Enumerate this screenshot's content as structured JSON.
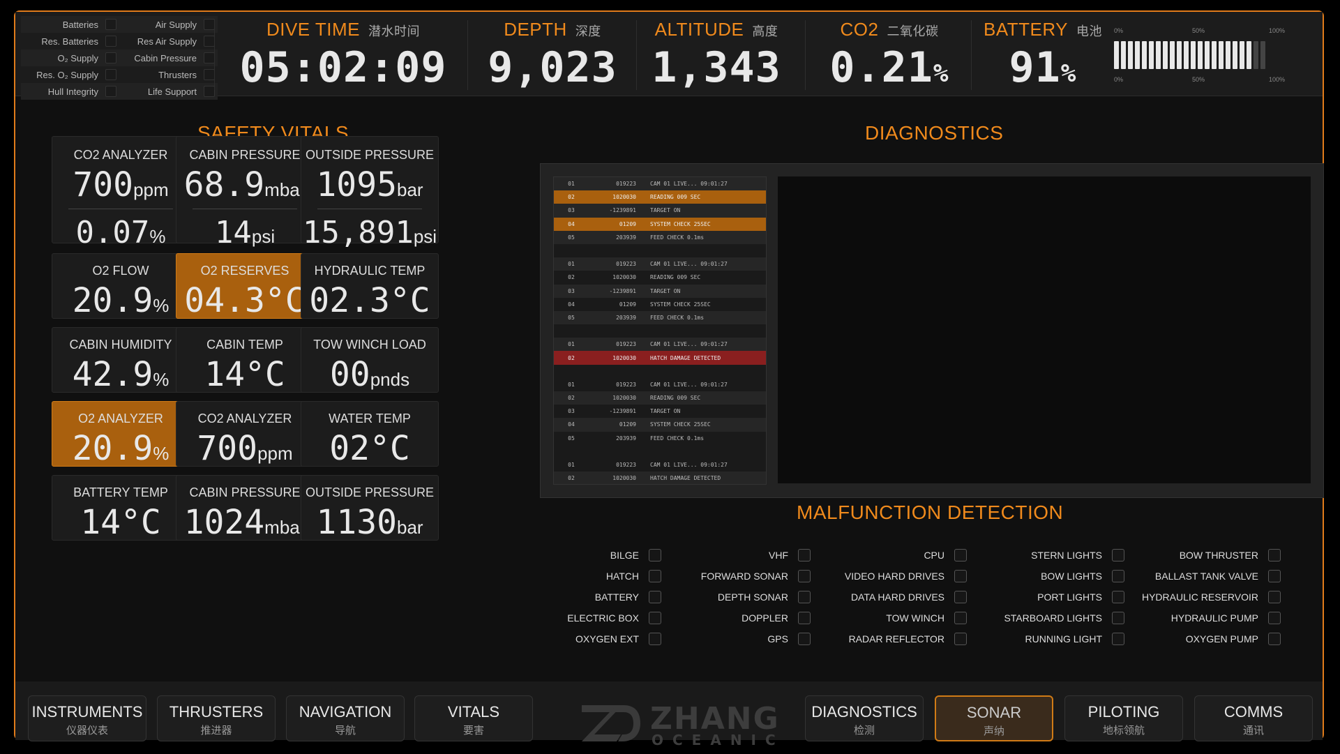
{
  "status_panel": [
    {
      "left": "Batteries",
      "right": "Air Supply"
    },
    {
      "left": "Res. Batteries",
      "right": "Res Air Supply"
    },
    {
      "left": "O₂ Supply",
      "right": "Cabin Pressure"
    },
    {
      "left": "Res. O₂ Supply",
      "right": "Thrusters"
    },
    {
      "left": "Hull Integrity",
      "right": "Life Support"
    }
  ],
  "metrics": {
    "dive_time": {
      "label": "DIVE TIME",
      "zh": "潜水时间",
      "value": "05:02:09"
    },
    "depth": {
      "label": "DEPTH",
      "zh": "深度",
      "value": "9,023"
    },
    "altitude": {
      "label": "ALTITUDE",
      "zh": "高度",
      "value": "1,343"
    },
    "co2": {
      "label": "CO2",
      "zh": "二氧化碳",
      "value": "0.21",
      "unit": "%"
    },
    "battery": {
      "label": "BATTERY",
      "zh": "电池",
      "value": "91",
      "unit": "%"
    }
  },
  "battery_gauge": {
    "level_percent": 91,
    "scale": [
      "0%",
      "50%",
      "100%"
    ]
  },
  "safety_vitals": {
    "title": "SAFETY VITALS",
    "tiles": [
      {
        "label": "CO2 ANALYZER",
        "value": "700",
        "unit": "ppm",
        "value2": "0.07",
        "unit2": "%"
      },
      {
        "label": "CABIN PRESSURE",
        "value": "68.9",
        "unit": "mbar",
        "value2": "14",
        "unit2": "psi"
      },
      {
        "label": "OUTSIDE PRESSURE",
        "value": "1095",
        "unit": "bar",
        "value2": "15,891",
        "unit2": "psi"
      },
      {
        "label": "O2 FLOW",
        "value": "20.9",
        "unit": "%"
      },
      {
        "label": "O2 RESERVES",
        "value": "04.3°C",
        "unit": "",
        "alert": true
      },
      {
        "label": "HYDRAULIC TEMP",
        "value": "02.3°C",
        "unit": ""
      },
      {
        "label": "CABIN HUMIDITY",
        "value": "42.9",
        "unit": "%"
      },
      {
        "label": "CABIN TEMP",
        "value": "14°C",
        "unit": ""
      },
      {
        "label": "TOW WINCH LOAD",
        "value": "00",
        "unit": "pnds"
      },
      {
        "label": "O2 ANALYZER",
        "value": "20.9",
        "unit": "%",
        "alert": true
      },
      {
        "label": "CO2 ANALYZER",
        "value": "700",
        "unit": "ppm"
      },
      {
        "label": "WATER TEMP",
        "value": "02°C",
        "unit": ""
      },
      {
        "label": "BATTERY TEMP",
        "value": "14°C",
        "unit": ""
      },
      {
        "label": "CABIN PRESSURE",
        "value": "1024",
        "unit": "mbar"
      },
      {
        "label": "OUTSIDE PRESSURE",
        "value": "1130",
        "unit": "bar"
      }
    ]
  },
  "diagnostics": {
    "title": "DIAGNOSTICS",
    "log": [
      {
        "id": "01",
        "code": "019223",
        "msg": "CAM 01 LIVE... 09:01:27"
      },
      {
        "id": "02",
        "code": "1020030",
        "msg": "READING 009 SEC",
        "state": "warn"
      },
      {
        "id": "03",
        "code": "-1239891",
        "msg": "TARGET ON"
      },
      {
        "id": "04",
        "code": "01209",
        "msg": "SYSTEM CHECK 25SEC",
        "state": "warn"
      },
      {
        "id": "05",
        "code": "203939",
        "msg": "FEED CHECK 0.1ms"
      },
      {
        "blank": true
      },
      {
        "id": "01",
        "code": "019223",
        "msg": "CAM 01 LIVE... 09:01:27"
      },
      {
        "id": "02",
        "code": "1020030",
        "msg": "READING 009 SEC"
      },
      {
        "id": "03",
        "code": "-1239891",
        "msg": "TARGET ON"
      },
      {
        "id": "04",
        "code": "01209",
        "msg": "SYSTEM CHECK 25SEC"
      },
      {
        "id": "05",
        "code": "203939",
        "msg": "FEED CHECK 0.1ms"
      },
      {
        "blank": true
      },
      {
        "id": "01",
        "code": "019223",
        "msg": "CAM 01 LIVE... 09:01:27"
      },
      {
        "id": "02",
        "code": "1020030",
        "msg": "HATCH DAMAGE DETECTED",
        "state": "crit"
      },
      {
        "blank": true
      },
      {
        "id": "01",
        "code": "019223",
        "msg": "CAM 01 LIVE... 09:01:27"
      },
      {
        "id": "02",
        "code": "1020030",
        "msg": "READING 009 SEC"
      },
      {
        "id": "03",
        "code": "-1239891",
        "msg": "TARGET ON"
      },
      {
        "id": "04",
        "code": "01209",
        "msg": "SYSTEM CHECK 25SEC"
      },
      {
        "id": "05",
        "code": "203939",
        "msg": "FEED CHECK 0.1ms"
      },
      {
        "blank": true
      },
      {
        "id": "01",
        "code": "019223",
        "msg": "CAM 01 LIVE... 09:01:27"
      },
      {
        "id": "02",
        "code": "1020030",
        "msg": "HATCH DAMAGE DETECTED"
      }
    ]
  },
  "malfunction": {
    "title": "MALFUNCTION DETECTION",
    "columns": [
      [
        "BILGE",
        "HATCH",
        "BATTERY",
        "ELECTRIC BOX",
        "OXYGEN EXT"
      ],
      [
        "VHF",
        "FORWARD SONAR",
        "DEPTH SONAR",
        "DOPPLER",
        "GPS"
      ],
      [
        "CPU",
        "VIDEO HARD DRIVES",
        "DATA HARD DRIVES",
        "TOW WINCH",
        "RADAR REFLECTOR"
      ],
      [
        "STERN LIGHTS",
        "BOW LIGHTS",
        "PORT LIGHTS",
        "STARBOARD LIGHTS",
        "RUNNING LIGHT"
      ],
      [
        "BOW THRUSTER",
        "BALLAST TANK VALVE",
        "HYDRAULIC RESERVOIR",
        "HYDRAULIC PUMP",
        "OXYGEN PUMP"
      ]
    ]
  },
  "nav": [
    {
      "en": "INSTRUMENTS",
      "zh": "仪器仪表"
    },
    {
      "en": "THRUSTERS",
      "zh": "推进器"
    },
    {
      "en": "NAVIGATION",
      "zh": "导航"
    },
    {
      "en": "VITALS",
      "zh": "要害"
    },
    {
      "en": "DIAGNOSTICS",
      "zh": "检测"
    },
    {
      "en": "SONAR",
      "zh": "声纳",
      "active": true
    },
    {
      "en": "PILOTING",
      "zh": "地标领航"
    },
    {
      "en": "COMMS",
      "zh": "通讯"
    }
  ],
  "logo": {
    "name": "ZHANG",
    "sub": "OCEANIC"
  },
  "colors": {
    "accent": "#f08a1c",
    "alert_tile": "#a9600e",
    "critical": "#8a1f1f"
  }
}
